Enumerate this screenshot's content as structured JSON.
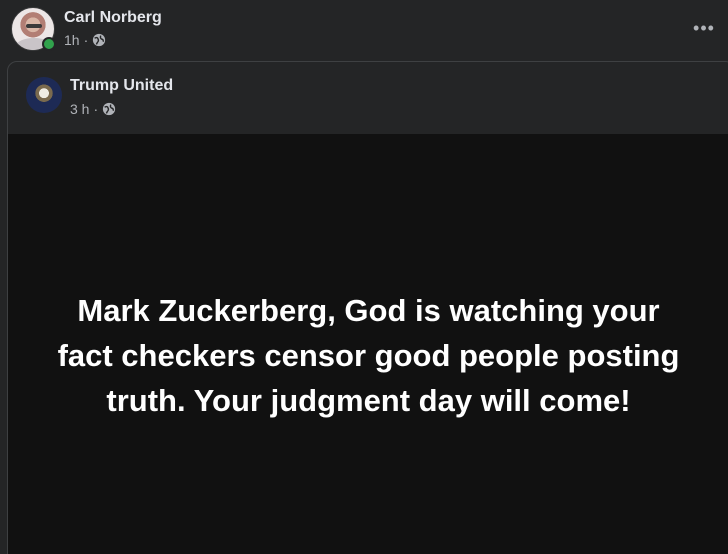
{
  "post": {
    "author": "Carl Norberg",
    "time": "1h",
    "separator": "·",
    "privacy_icon": "globe-icon",
    "more_icon": "•••"
  },
  "shared_post": {
    "page_name": "Trump United",
    "time": "3 h",
    "separator": "·",
    "privacy_icon": "globe-icon",
    "text": "Mark Zuckerberg, God is watching your fact checkers censor good people posting truth. Your judgment day will come!"
  },
  "colors": {
    "background": "#242526",
    "card_background": "#111111",
    "online_status": "#31a24c",
    "secondary_text": "#b0b3b8"
  }
}
